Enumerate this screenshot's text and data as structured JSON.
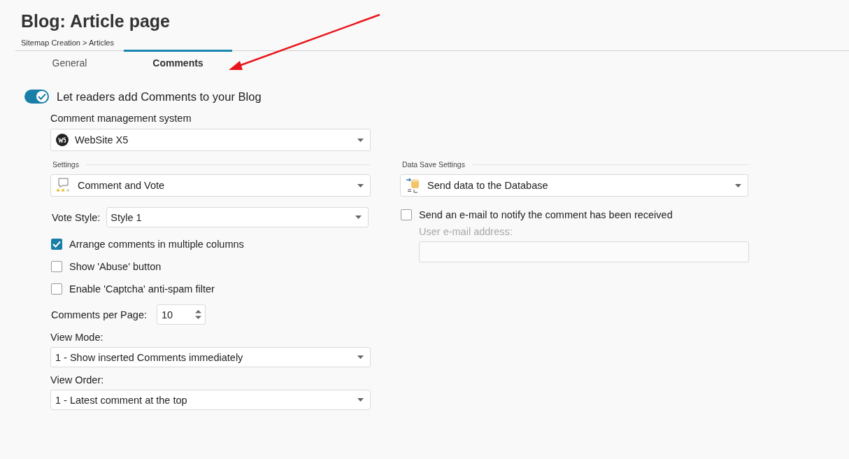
{
  "page": {
    "title": "Blog: Article page",
    "breadcrumb": "Sitemap Creation > Articles"
  },
  "tabs": [
    {
      "label": "General",
      "selected": false
    },
    {
      "label": "Comments",
      "selected": true
    }
  ],
  "enable_toggle": {
    "label": "Let readers add Comments to your Blog",
    "on": true
  },
  "left": {
    "cms_label": "Comment management system",
    "cms_value": "WebSite X5",
    "settings_heading": "Settings",
    "settings_value": "Comment and Vote",
    "vote_style_label": "Vote Style:",
    "vote_style_value": "Style 1",
    "options": [
      {
        "label": "Arrange comments in multiple columns",
        "checked": true
      },
      {
        "label": "Show 'Abuse' button",
        "checked": false
      },
      {
        "label": "Enable 'Captcha' anti-spam filter",
        "checked": false
      }
    ],
    "per_page_label": "Comments per Page:",
    "per_page_value": "10",
    "view_mode_label": "View Mode:",
    "view_mode_value": "1 - Show inserted Comments immediately",
    "view_order_label": "View Order:",
    "view_order_value": "1 - Latest comment at the top"
  },
  "right": {
    "heading": "Data Save Settings",
    "save_value": "Send data to the Database",
    "notify": {
      "label": "Send an e-mail to notify the comment has been received",
      "checked": false
    },
    "email_label": "User e-mail address:",
    "email_disabled": true
  }
}
